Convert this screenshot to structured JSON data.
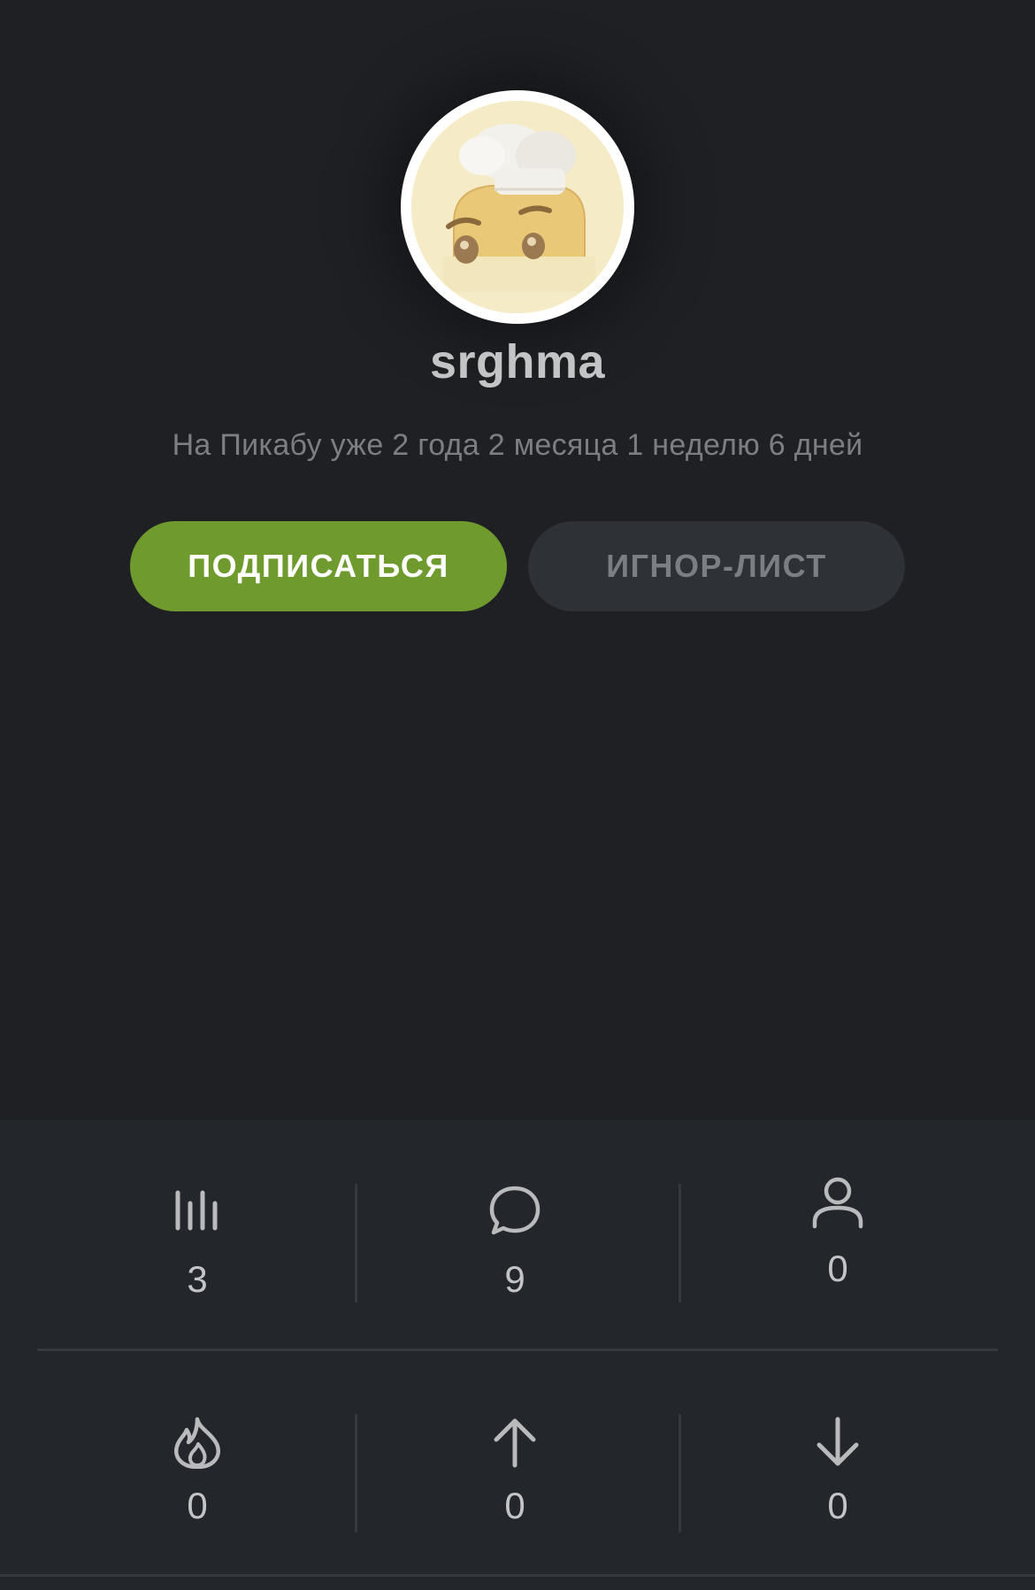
{
  "profile": {
    "username": "srghma",
    "tenure": "На Пикабу уже 2 года 2 месяца 1 неделю 6 дней",
    "avatar": "chef-toast-avatar"
  },
  "actions": {
    "subscribe_label": "ПОДПИСАТЬСЯ",
    "ignore_label": "ИГНОР-ЛИСТ"
  },
  "stats": {
    "rating": {
      "icon": "rating-bars-icon",
      "value": "3"
    },
    "comments": {
      "icon": "comment-bubble-icon",
      "value": "9"
    },
    "subscribers": {
      "icon": "user-icon",
      "value": "0"
    },
    "hot": {
      "icon": "fire-icon",
      "value": "0"
    },
    "pluses": {
      "icon": "arrow-up-icon",
      "value": "0"
    },
    "minuses": {
      "icon": "arrow-down-icon",
      "value": "0"
    }
  },
  "colors": {
    "background": "#1e2024",
    "panel": "#23262a",
    "accent_green": "#6f9b2e",
    "muted_button": "#2e3135"
  }
}
